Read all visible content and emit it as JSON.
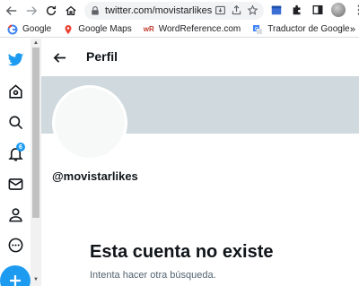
{
  "browser": {
    "url": "twitter.com/movistarlikes"
  },
  "bookmarks": [
    {
      "label": "Google",
      "icon": "google-icon"
    },
    {
      "label": "Google Maps",
      "icon": "maps-pin-icon"
    },
    {
      "label": "WordReference.com",
      "icon": "wordreference-icon"
    },
    {
      "label": "Traductor de Google",
      "icon": "translate-icon"
    }
  ],
  "bookmarks_more": "»",
  "twitter": {
    "notification_count": "6",
    "nav_icons": [
      "twitter-logo-icon",
      "explore-icon",
      "search-icon",
      "notifications-icon",
      "messages-icon",
      "profile-icon",
      "more-icon",
      "tweet-compose-icon"
    ]
  },
  "profile": {
    "title": "Perfil",
    "handle": "@movistarlikes",
    "empty_title": "Esta cuenta no existe",
    "empty_subtitle": "Intenta hacer otra búsqueda."
  },
  "colors": {
    "twitter_blue": "#1d9bf0",
    "banner_gray": "#cfd9de",
    "secondary_text": "#536471"
  }
}
